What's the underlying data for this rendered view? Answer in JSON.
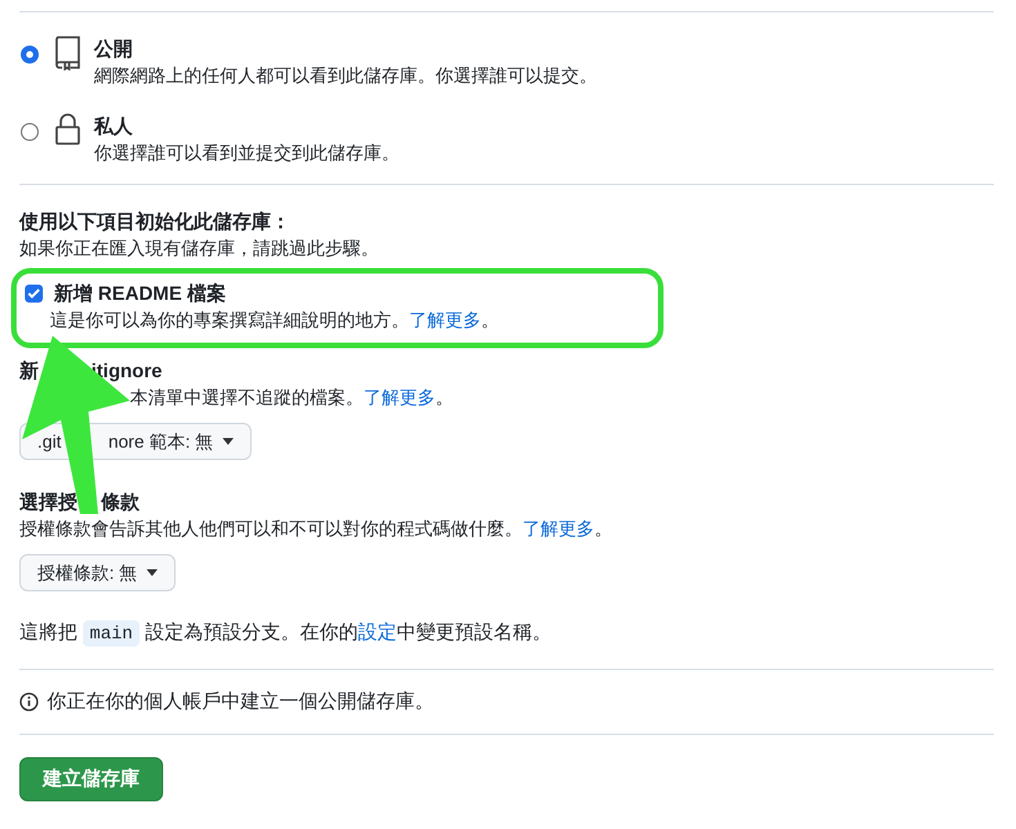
{
  "visibility": [
    {
      "kind": "public",
      "title": "公開",
      "description": "網際網路上的任何人都可以看到此儲存庫。你選擇誰可以提交。",
      "selected": true
    },
    {
      "kind": "private",
      "title": "私人",
      "description": "你選擇誰可以看到並提交到此儲存庫。",
      "selected": false
    }
  ],
  "init": {
    "heading": "使用以下項目初始化此儲存庫：",
    "hint": "如果你正在匯入現有儲存庫，請跳過此步驟。",
    "readme": {
      "label": "新增 README 檔案",
      "checked": true,
      "description": "這是你可以為你的專案撰寫詳細說明的地方。",
      "link": "了解更多",
      "suffix": "。"
    },
    "gitignore": {
      "title_parts": [
        "新",
        "itignore"
      ],
      "description": "本清單中選擇不追蹤的檔案。",
      "link": "了解更多",
      "suffix": "。",
      "button_parts": [
        ".git",
        "nore 範本: 無"
      ]
    },
    "license": {
      "title_parts": [
        "選擇授",
        "條款"
      ],
      "description": "授權條款會告訴其他人他們可以和不可以對你的程式碼做什麼。",
      "link": "了解更多",
      "suffix": "。",
      "button": "授權條款: 無"
    }
  },
  "branch_note": {
    "before": "這將把",
    "code": "main",
    "middle": "設定為預設分支。在你的",
    "link": "設定",
    "after": "中變更預設名稱。"
  },
  "info": "你正在你的個人帳戶中建立一個公開儲存庫。",
  "submit": "建立儲存庫"
}
